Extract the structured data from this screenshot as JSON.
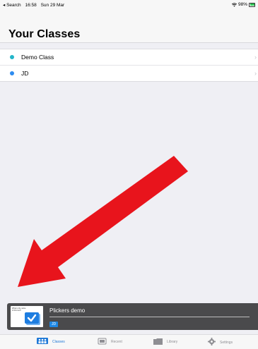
{
  "status": {
    "back": "◂ Search",
    "time": "16:58",
    "date": "Sun 29 Mar",
    "battery": "98%"
  },
  "page": {
    "title": "Your Classes"
  },
  "classes": [
    {
      "name": "Demo Class",
      "color": "#22b5c9"
    },
    {
      "name": "JD",
      "color": "#2d8cf0"
    }
  ],
  "player": {
    "title": "Plickers demo",
    "badge": "JD",
    "thumb_text": "What is the name of this tool?"
  },
  "tabs": [
    {
      "label": "Classes",
      "icon": "classes-icon",
      "active": true
    },
    {
      "label": "Recent",
      "icon": "recent-icon",
      "active": false
    },
    {
      "label": "Library",
      "icon": "folder-icon",
      "active": false
    },
    {
      "label": "Settings",
      "icon": "gear-icon",
      "active": false
    }
  ],
  "colors": {
    "accent": "#1e78d7",
    "arrow": "#e8141c"
  }
}
